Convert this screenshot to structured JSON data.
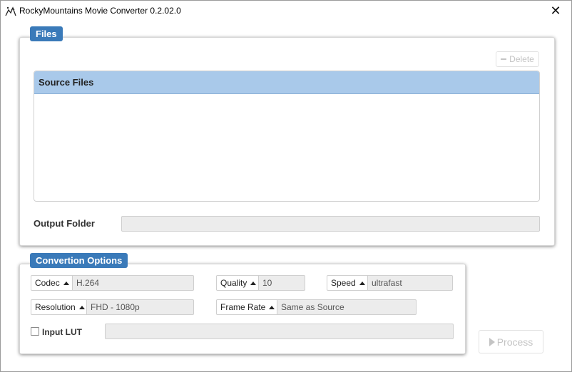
{
  "window": {
    "title": "RockyMountains Movie Converter 0.2.02.0",
    "close_glyph": "✕"
  },
  "files": {
    "legend": "Files",
    "delete_label": "Delete",
    "table_header": "Source Files",
    "output_folder_label": "Output Folder",
    "output_folder_value": ""
  },
  "options": {
    "legend": "Convertion Options",
    "codec": {
      "label": "Codec",
      "value": "H.264"
    },
    "quality": {
      "label": "Quality",
      "value": "10"
    },
    "speed": {
      "label": "Speed",
      "value": "ultrafast"
    },
    "resolution": {
      "label": "Resolution",
      "value": "FHD - 1080p"
    },
    "frame_rate": {
      "label": "Frame Rate",
      "value": "Same as Source"
    },
    "input_lut": {
      "label": "Input LUT",
      "checked": false,
      "value": ""
    }
  },
  "process_label": "Process",
  "colors": {
    "accent": "#3a7ab9",
    "table_header": "#a9c9ea",
    "disabled_text": "#c4c4c4"
  }
}
